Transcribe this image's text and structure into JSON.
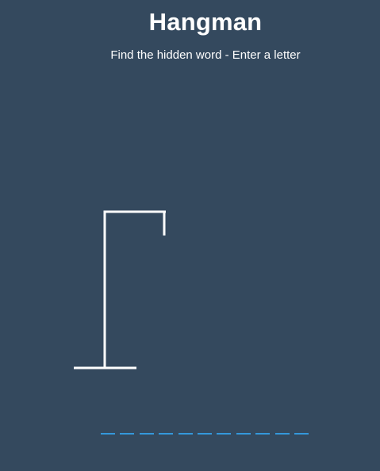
{
  "game": {
    "title": "Hangman",
    "instructions": "Find the hidden word - Enter a letter"
  },
  "word": {
    "length": 11,
    "revealed_letters": [
      "",
      "",
      "",
      "",
      "",
      "",
      "",
      "",
      "",
      "",
      ""
    ]
  },
  "wrong_guesses": 0,
  "colors": {
    "background": "#34495e",
    "figure": "#ffffff",
    "letter_underline": "#3498db"
  }
}
